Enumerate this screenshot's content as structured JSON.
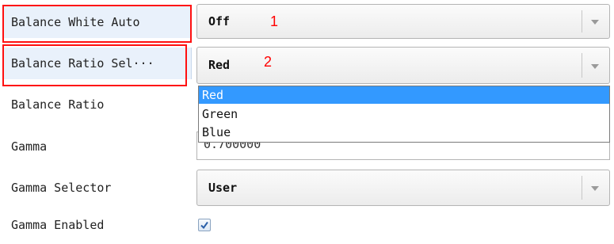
{
  "properties": [
    {
      "label": "Balance White Auto",
      "value": "Off",
      "marker": "1"
    },
    {
      "label": "Balance Ratio Sel···",
      "value": "Red",
      "marker": "2"
    },
    {
      "label": "Balance Ratio",
      "value": ""
    },
    {
      "label": "Gamma",
      "value": "0.700000"
    },
    {
      "label": "Gamma Selector",
      "value": "User"
    },
    {
      "label": "Gamma Enabled",
      "checked": true
    }
  ],
  "dropdown": {
    "options": [
      "Red",
      "Green",
      "Blue"
    ],
    "selected": "Red"
  },
  "colors": {
    "highlight": "#3399ff",
    "annotation": "#ff0000"
  },
  "icons": {
    "combo_arrow": "chevron-down-icon",
    "checkbox": "checkmark-icon"
  }
}
